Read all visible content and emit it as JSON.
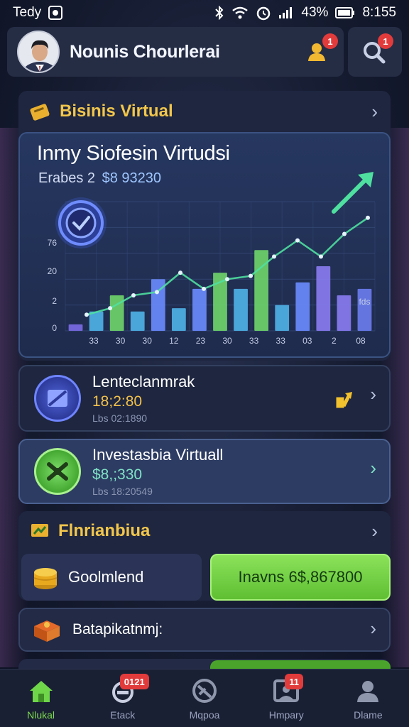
{
  "status_bar": {
    "carrier": "Tedy",
    "battery": "43%",
    "time": "8:155"
  },
  "header": {
    "user_name": "Nounis Chourlerai",
    "notification_badge": "1",
    "search_badge": "1"
  },
  "business": {
    "title": "Bisinis Virtual"
  },
  "chart_card": {
    "title": "Inmy Siofesin Virtudsi",
    "subtitle_label": "Erabes 2",
    "subtitle_value": "$8 93230"
  },
  "chart_data": {
    "type": "bar",
    "y_tick_labels": [
      "0",
      "2",
      "20",
      "76"
    ],
    "x_tick_labels": [
      "33",
      "30",
      "30",
      "12",
      "23",
      "30",
      "33",
      "33",
      "03",
      "2",
      "08"
    ],
    "bar_values": [
      4,
      12,
      22,
      12,
      32,
      14,
      26,
      36,
      26,
      50,
      16,
      30,
      40,
      22,
      26
    ],
    "bar_colors": [
      "#7b6be6",
      "#4fb3e8",
      "#6fd66a",
      "#4fb3e8",
      "#6b8cff",
      "#4fb3e8",
      "#6b8cff",
      "#6fd66a",
      "#4fb3e8",
      "#6fd66a",
      "#4fb3e8",
      "#6b8cff",
      "#8a7cf2",
      "#8a7cf2",
      "#6b7df0"
    ],
    "line_values": [
      10,
      14,
      22,
      24,
      36,
      26,
      32,
      34,
      46,
      56,
      46,
      60,
      70
    ],
    "ylim": [
      0,
      80
    ],
    "last_bar_label": "fds",
    "grid": true,
    "accent_color": "#4fe0a0"
  },
  "cards": [
    {
      "title": "Lenteclanmrak",
      "value": "18;2:80",
      "sub": "Lbs 02:1890",
      "value_color": "#f3c14a"
    },
    {
      "title": "Investasbia Virtuall",
      "value": "$8,;330",
      "sub": "Lbs 18:20549",
      "value_color": "#7fe3c6"
    }
  ],
  "finance": {
    "title": "Flnrianbiua",
    "gold_label": "Goolmlend",
    "invest_label": "Inavns 6$,867800"
  },
  "bat": {
    "label": "Batapikatnmj:"
  },
  "bottom_nav": [
    {
      "label": "Nlukal",
      "icon": "home-icon",
      "badge": ""
    },
    {
      "label": "Etack",
      "icon": "stack-icon",
      "badge": "0121"
    },
    {
      "label": "Mqpoa",
      "icon": "globe-icon",
      "badge": ""
    },
    {
      "label": "Hmpary",
      "icon": "history-icon",
      "badge": "11"
    },
    {
      "label": "Dlame",
      "icon": "profile-icon",
      "badge": ""
    }
  ]
}
